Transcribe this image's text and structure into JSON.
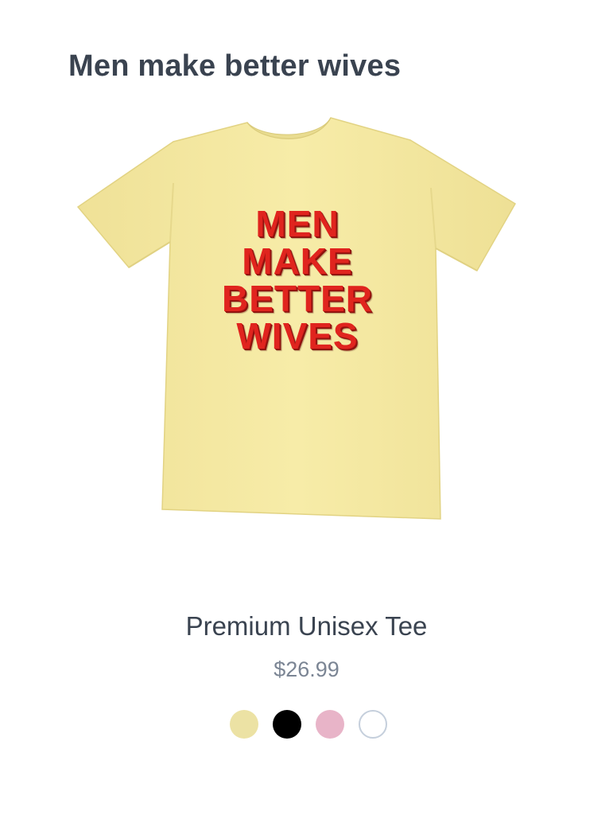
{
  "header": {
    "title": "Men make better wives"
  },
  "product": {
    "print_lines": [
      "MEN",
      "MAKE",
      "BETTER",
      "WIVES"
    ],
    "shirt_color": "#f5e9a0",
    "print_color": "#e0241e",
    "name": "Premium Unisex Tee",
    "price": "$26.99"
  },
  "swatches": [
    {
      "name": "yellow",
      "color": "#ece2a4"
    },
    {
      "name": "black",
      "color": "#000000"
    },
    {
      "name": "pink",
      "color": "#e8b4c8"
    },
    {
      "name": "white",
      "color": "#ffffff"
    }
  ]
}
